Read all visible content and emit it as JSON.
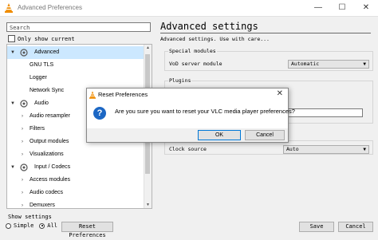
{
  "window": {
    "title": "Advanced Preferences",
    "minimize": "—",
    "maximize": "☐",
    "close": "✕"
  },
  "left": {
    "search_placeholder": "Search",
    "only_show_current": "Only show current",
    "tree": [
      {
        "label": "Advanced",
        "level": 0,
        "expanded": true,
        "selected": true,
        "icon": "advanced-icon"
      },
      {
        "label": "GNU TLS",
        "level": 1
      },
      {
        "label": "Logger",
        "level": 1
      },
      {
        "label": "Network Sync",
        "level": 1
      },
      {
        "label": "Audio",
        "level": 0,
        "expanded": true,
        "icon": "audio-icon"
      },
      {
        "label": "Audio resampler",
        "level": 1,
        "collapsed": true
      },
      {
        "label": "Filters",
        "level": 1,
        "collapsed": true
      },
      {
        "label": "Output modules",
        "level": 1,
        "collapsed": true
      },
      {
        "label": "Visualizations",
        "level": 1,
        "collapsed": true
      },
      {
        "label": "Input / Codecs",
        "level": 0,
        "expanded": true,
        "icon": "input-codecs-icon"
      },
      {
        "label": "Access modules",
        "level": 1,
        "collapsed": true
      },
      {
        "label": "Audio codecs",
        "level": 1,
        "collapsed": true
      },
      {
        "label": "Demuxers",
        "level": 1,
        "collapsed": true
      }
    ]
  },
  "right": {
    "heading": "Advanced settings",
    "subtext": "Advanced settings. Use with care...",
    "special_modules": {
      "title": "Special modules",
      "vod_label": "VoD server module",
      "vod_value": "Automatic"
    },
    "plugins": {
      "title": "Plugins"
    },
    "clock": {
      "label": "Clock source",
      "value": "Auto"
    }
  },
  "bottom": {
    "show_settings": "Show settings",
    "simple": "Simple",
    "all": "All",
    "reset": "Reset Preferences",
    "save": "Save",
    "cancel": "Cancel"
  },
  "dialog": {
    "title": "Reset Preferences",
    "close": "✕",
    "message": "Are you sure you want to reset your VLC media player preferences?",
    "ok": "OK",
    "cancel": "Cancel"
  },
  "colors": {
    "selection": "#cce8ff",
    "vlc_orange": "#f08c00",
    "question_blue": "#1c67c4"
  }
}
